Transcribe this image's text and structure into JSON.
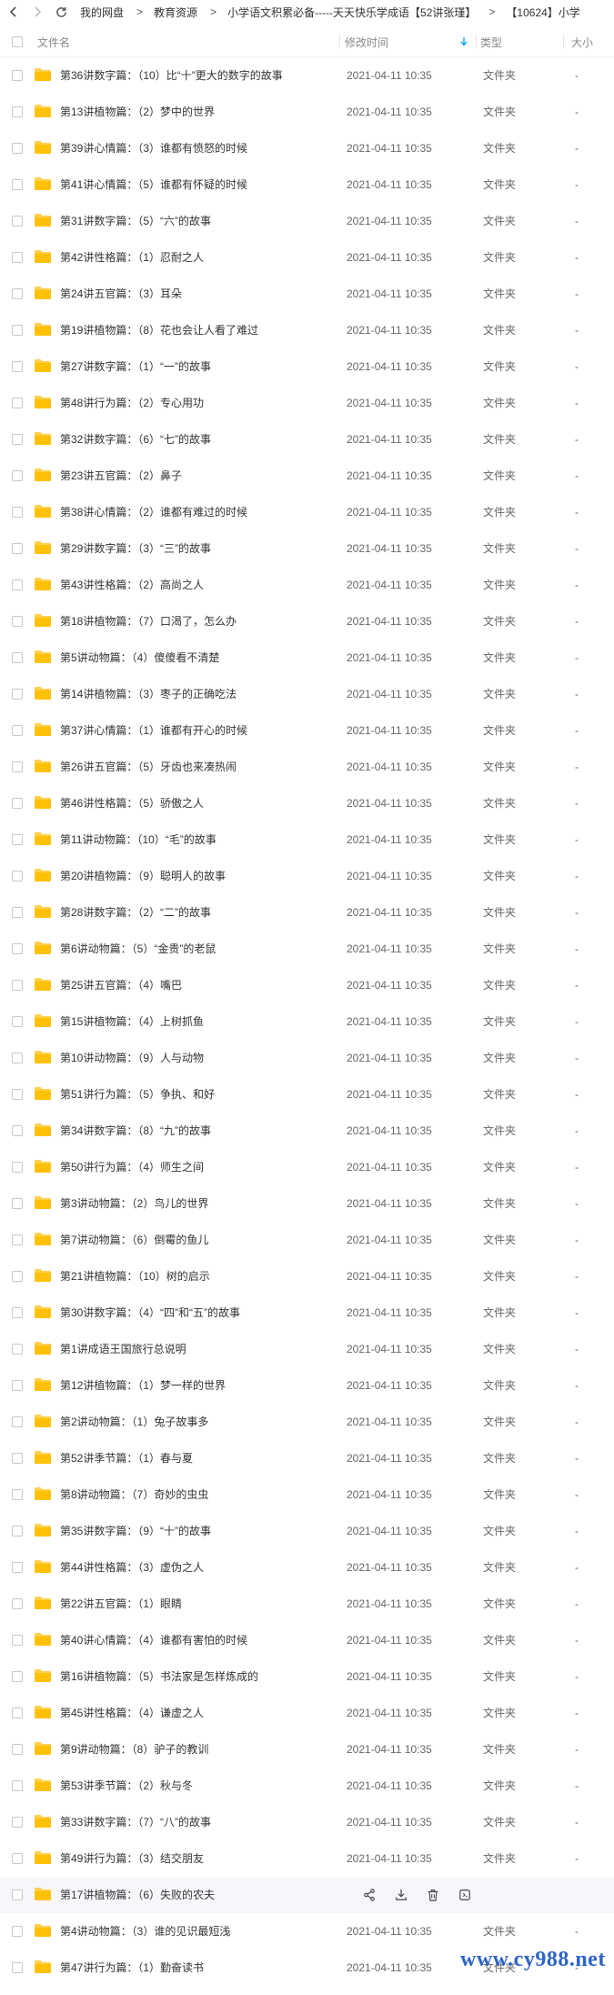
{
  "nav": {
    "back_icon": "chevron-left-icon",
    "forward_icon": "chevron-right-icon",
    "refresh_icon": "refresh-icon",
    "breadcrumb": [
      "我的网盘",
      "教育资源",
      "小学语文积累必备-----天天快乐学成语【52讲张瑾】",
      "【10624】小学"
    ],
    "separator": ">"
  },
  "table": {
    "columns": {
      "name": "文件名",
      "modified": "修改时间",
      "type": "类型",
      "size": "大小"
    },
    "sort_icon": "arrow-down-icon",
    "rows": [
      {
        "name": "第36讲数字篇：（10）比“十”更大的数字的故事",
        "time": "2021-04-11 10:35",
        "type": "文件夹",
        "size": "-"
      },
      {
        "name": "第13讲植物篇：（2）梦中的世界",
        "time": "2021-04-11 10:35",
        "type": "文件夹",
        "size": "-"
      },
      {
        "name": "第39讲心情篇：（3）谁都有愤怒的时候",
        "time": "2021-04-11 10:35",
        "type": "文件夹",
        "size": "-"
      },
      {
        "name": "第41讲心情篇：（5）谁都有怀疑的时候",
        "time": "2021-04-11 10:35",
        "type": "文件夹",
        "size": "-"
      },
      {
        "name": "第31讲数字篇：（5）“六”的故事",
        "time": "2021-04-11 10:35",
        "type": "文件夹",
        "size": "-"
      },
      {
        "name": "第42讲性格篇：（1）忍耐之人",
        "time": "2021-04-11 10:35",
        "type": "文件夹",
        "size": "-"
      },
      {
        "name": "第24讲五官篇：（3）耳朵",
        "time": "2021-04-11 10:35",
        "type": "文件夹",
        "size": "-"
      },
      {
        "name": "第19讲植物篇：（8）花也会让人看了难过",
        "time": "2021-04-11 10:35",
        "type": "文件夹",
        "size": "-"
      },
      {
        "name": "第27讲数字篇：（1）“一”的故事",
        "time": "2021-04-11 10:35",
        "type": "文件夹",
        "size": "-"
      },
      {
        "name": "第48讲行为篇：（2）专心用功",
        "time": "2021-04-11 10:35",
        "type": "文件夹",
        "size": "-"
      },
      {
        "name": "第32讲数字篇：（6）“七”的故事",
        "time": "2021-04-11 10:35",
        "type": "文件夹",
        "size": "-"
      },
      {
        "name": "第23讲五官篇：（2）鼻子",
        "time": "2021-04-11 10:35",
        "type": "文件夹",
        "size": "-"
      },
      {
        "name": "第38讲心情篇：（2）谁都有难过的时候",
        "time": "2021-04-11 10:35",
        "type": "文件夹",
        "size": "-"
      },
      {
        "name": "第29讲数字篇：（3）“三”的故事",
        "time": "2021-04-11 10:35",
        "type": "文件夹",
        "size": "-"
      },
      {
        "name": "第43讲性格篇：（2）高尚之人",
        "time": "2021-04-11 10:35",
        "type": "文件夹",
        "size": "-"
      },
      {
        "name": "第18讲植物篇：（7）口渴了，怎么办",
        "time": "2021-04-11 10:35",
        "type": "文件夹",
        "size": "-"
      },
      {
        "name": "第5讲动物篇：（4）傻傻看不清楚",
        "time": "2021-04-11 10:35",
        "type": "文件夹",
        "size": "-"
      },
      {
        "name": "第14讲植物篇：（3）枣子的正确吃法",
        "time": "2021-04-11 10:35",
        "type": "文件夹",
        "size": "-"
      },
      {
        "name": "第37讲心情篇：（1）谁都有开心的时候",
        "time": "2021-04-11 10:35",
        "type": "文件夹",
        "size": "-"
      },
      {
        "name": "第26讲五官篇：（5）牙齿也来凑热闹",
        "time": "2021-04-11 10:35",
        "type": "文件夹",
        "size": "-"
      },
      {
        "name": "第46讲性格篇：（5）骄傲之人",
        "time": "2021-04-11 10:35",
        "type": "文件夹",
        "size": "-"
      },
      {
        "name": "第11讲动物篇：（10）“毛”的故事",
        "time": "2021-04-11 10:35",
        "type": "文件夹",
        "size": "-"
      },
      {
        "name": "第20讲植物篇：（9）聪明人的故事",
        "time": "2021-04-11 10:35",
        "type": "文件夹",
        "size": "-"
      },
      {
        "name": "第28讲数字篇：（2）“二”的故事",
        "time": "2021-04-11 10:35",
        "type": "文件夹",
        "size": "-"
      },
      {
        "name": "第6讲动物篇：（5）“金贵”的老鼠",
        "time": "2021-04-11 10:35",
        "type": "文件夹",
        "size": "-"
      },
      {
        "name": "第25讲五官篇：（4）嘴巴",
        "time": "2021-04-11 10:35",
        "type": "文件夹",
        "size": "-"
      },
      {
        "name": "第15讲植物篇：（4）上树抓鱼",
        "time": "2021-04-11 10:35",
        "type": "文件夹",
        "size": "-"
      },
      {
        "name": "第10讲动物篇：（9）人与动物",
        "time": "2021-04-11 10:35",
        "type": "文件夹",
        "size": "-"
      },
      {
        "name": "第51讲行为篇：（5）争执、和好",
        "time": "2021-04-11 10:35",
        "type": "文件夹",
        "size": "-"
      },
      {
        "name": "第34讲数字篇：（8）“九”的故事",
        "time": "2021-04-11 10:35",
        "type": "文件夹",
        "size": "-"
      },
      {
        "name": "第50讲行为篇：（4）师生之间",
        "time": "2021-04-11 10:35",
        "type": "文件夹",
        "size": "-"
      },
      {
        "name": "第3讲动物篇：（2）鸟儿的世界",
        "time": "2021-04-11 10:35",
        "type": "文件夹",
        "size": "-"
      },
      {
        "name": "第7讲动物篇：（6）倒霉的鱼儿",
        "time": "2021-04-11 10:35",
        "type": "文件夹",
        "size": "-"
      },
      {
        "name": "第21讲植物篇：（10）树的启示",
        "time": "2021-04-11 10:35",
        "type": "文件夹",
        "size": "-"
      },
      {
        "name": "第30讲数字篇：（4）“四”和“五”的故事",
        "time": "2021-04-11 10:35",
        "type": "文件夹",
        "size": "-"
      },
      {
        "name": "第1讲成语王国旅行总说明",
        "time": "2021-04-11 10:35",
        "type": "文件夹",
        "size": "-"
      },
      {
        "name": "第12讲植物篇：（1）梦一样的世界",
        "time": "2021-04-11 10:35",
        "type": "文件夹",
        "size": "-"
      },
      {
        "name": "第2讲动物篇：（1）兔子故事多",
        "time": "2021-04-11 10:35",
        "type": "文件夹",
        "size": "-"
      },
      {
        "name": "第52讲季节篇：（1）春与夏",
        "time": "2021-04-11 10:35",
        "type": "文件夹",
        "size": "-"
      },
      {
        "name": "第8讲动物篇：（7）奇妙的虫虫",
        "time": "2021-04-11 10:35",
        "type": "文件夹",
        "size": "-"
      },
      {
        "name": "第35讲数字篇：（9）“十”的故事",
        "time": "2021-04-11 10:35",
        "type": "文件夹",
        "size": "-"
      },
      {
        "name": "第44讲性格篇：（3）虚伪之人",
        "time": "2021-04-11 10:35",
        "type": "文件夹",
        "size": "-"
      },
      {
        "name": "第22讲五官篇：（1）眼睛",
        "time": "2021-04-11 10:35",
        "type": "文件夹",
        "size": "-"
      },
      {
        "name": "第40讲心情篇：（4）谁都有害怕的时候",
        "time": "2021-04-11 10:35",
        "type": "文件夹",
        "size": "-"
      },
      {
        "name": "第16讲植物篇：（5）书法家是怎样炼成的",
        "time": "2021-04-11 10:35",
        "type": "文件夹",
        "size": "-"
      },
      {
        "name": "第45讲性格篇：（4）谦虚之人",
        "time": "2021-04-11 10:35",
        "type": "文件夹",
        "size": "-"
      },
      {
        "name": "第9讲动物篇：（8）驴子的教训",
        "time": "2021-04-11 10:35",
        "type": "文件夹",
        "size": "-"
      },
      {
        "name": "第53讲季节篇：（2）秋与冬",
        "time": "2021-04-11 10:35",
        "type": "文件夹",
        "size": "-"
      },
      {
        "name": "第33讲数字篇：（7）“八”的故事",
        "time": "2021-04-11 10:35",
        "type": "文件夹",
        "size": "-"
      },
      {
        "name": "第49讲行为篇：（3）结交朋友",
        "time": "2021-04-11 10:35",
        "type": "文件夹",
        "size": "-"
      },
      {
        "name": "第17讲植物篇：（6）失败的农夫",
        "time": "",
        "type": "",
        "size": "",
        "hover": true
      },
      {
        "name": "第4讲动物篇：（3）谁的见识最短浅",
        "time": "2021-04-11 10:35",
        "type": "文件夹",
        "size": "-"
      },
      {
        "name": "第47讲行为篇：（1）勤奋读书",
        "time": "2021-04-11 10:35",
        "type": "文件夹",
        "size": "-"
      }
    ],
    "row_actions": [
      "share-icon",
      "download-icon",
      "delete-icon",
      "more-icon"
    ]
  },
  "watermark": "www.cy988.net"
}
